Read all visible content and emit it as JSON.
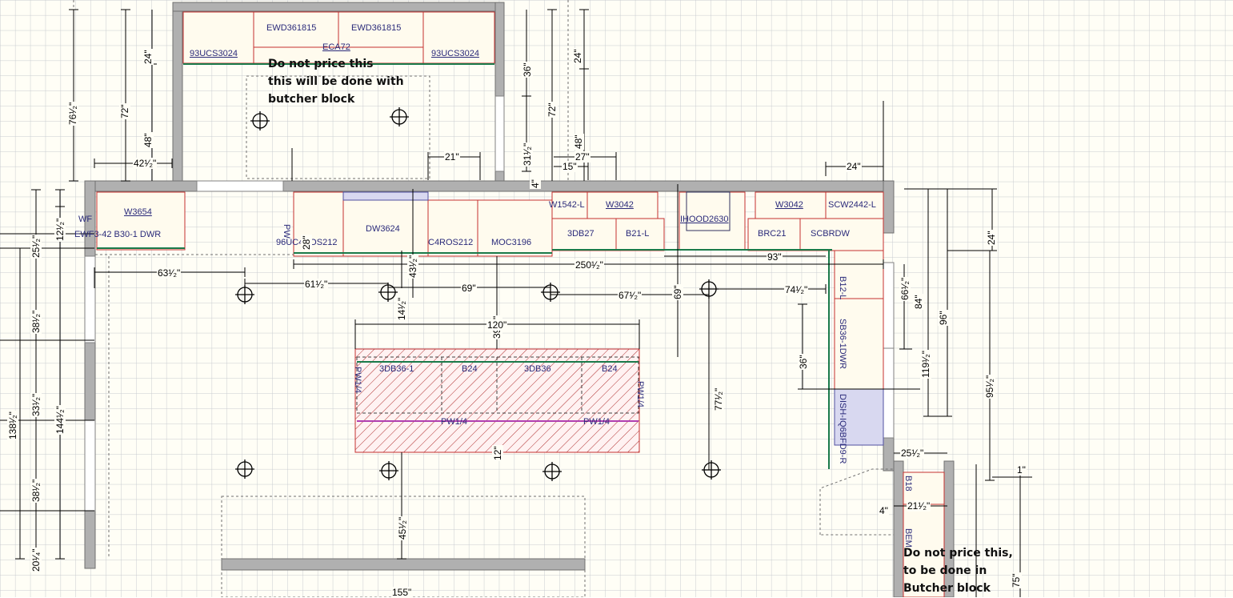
{
  "notes": {
    "butcher_block_1": [
      "Do not price this",
      "this will be done with",
      "butcher block"
    ],
    "butcher_block_2": [
      "Do not price this,",
      "to be done in",
      "Butcher block"
    ]
  },
  "cabinets": {
    "ewd_left": "EWD361815",
    "ewd_right": "EWD361815",
    "ucs_left": "93UCS3024",
    "ucs_right": "93UCS3024",
    "eca": "ECA72",
    "w3654": "W3654",
    "wf": "WF",
    "ewf_bdwr": "EWF3-42 B30-1 DWR",
    "uc4ros_left": "96UC4ROS212",
    "dw": "DW3624",
    "c4ros": "C4ROS212",
    "moc": "MOC3196",
    "w1542": "W1542-L",
    "w3042_a": "W3042",
    "db27": "3DB27",
    "b21": "B21-L",
    "ihood": "IHOOD2630",
    "w3042_b": "W3042",
    "scw": "SCW2442-L",
    "brc": "BRC21",
    "scbrdw": "SCBRDW",
    "b12": "B12-L",
    "sb36": "SB36-1DWR",
    "dish": "DISH-IQ6BFD9-R",
    "db36_a": "3DB36-1",
    "b24_a": "B24",
    "db36_b": "3DB36",
    "b24_b": "B24",
    "pw14_a": "PW1/4",
    "pw14_b": "PW1/4",
    "pw14_left": "PW1/4",
    "pw14_right": "PW1/4",
    "b18": "B18",
    "bem": "BEM",
    "pw_small": "PW"
  },
  "dimensions": {
    "d24_top": "24\"",
    "d76": "76¹⁄₂\"",
    "d72_l": "72\"",
    "d24_l": "24\"",
    "d48_l": "48\"",
    "d42": "42¹⁄₂\"",
    "d36_r": "36\"",
    "d72_r": "72\"",
    "d48_r": "48\"",
    "d31": "31¹⁄₂\"",
    "d4": "4\"",
    "d21": "21\"",
    "d27": "27\"",
    "d15": "15\"",
    "d24_right": "24\"",
    "d12": "12¹⁄₂\"",
    "d25": "25¹⁄₂\"",
    "d38_a": "38¹⁄₂\"",
    "d33": "33¹⁄₂\"",
    "d38_b": "38¹⁄₂\"",
    "d20": "20¹⁄₄\"",
    "d138": "138¹⁄₂\"",
    "d144": "144¹⁄₂\"",
    "d63": "63¹⁄₂\"",
    "d61": "61¹⁄₂\"",
    "d14": "14¹⁄₂\"",
    "d43": "43¹⁄₂\"",
    "d28": "28\"",
    "d69": "69\"",
    "d39": "39¹⁄₂\"",
    "d67": "67¹⁄₂\"",
    "d74": "74¹⁄₂\"",
    "d250": "250¹⁄₂\"",
    "d93": "93\"",
    "d69b": "69\"",
    "d120": "120\"",
    "d77": "77¹⁄₂\"",
    "d36_mid": "36\"",
    "d66": "66¹⁄₂\"",
    "d84": "84\"",
    "d96": "96\"",
    "d119": "119¹⁄₂\"",
    "d95": "95¹⁄₂\"",
    "d24_far": "24\"",
    "d25_b": "25¹⁄₂\"",
    "d21_b": "21¹⁄₂\"",
    "d4_b": "4\"",
    "d12_b": "12\"",
    "d45": "45¹⁄₂\"",
    "d155": "155\"",
    "d75": "75\"",
    "d1": "1\""
  },
  "colors": {
    "wall": "#b0b0b0",
    "cabinet_fill": "#fffbee",
    "cabinet_border": "#c43030",
    "grid": "#c8ccd0",
    "background": "#fffef6",
    "dimension_line": "#000000",
    "appliance_fill": "#d8d8f0",
    "island_hatch": "#b03030"
  }
}
